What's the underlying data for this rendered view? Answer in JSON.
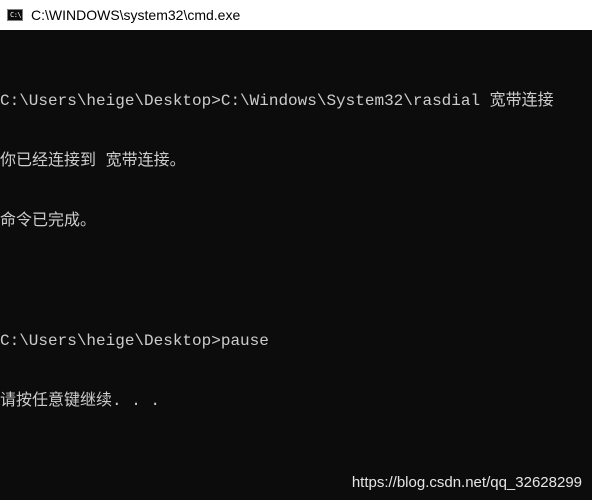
{
  "window": {
    "title": "C:\\WINDOWS\\system32\\cmd.exe",
    "icon": "cmd-icon"
  },
  "console": {
    "lines": [
      "C:\\Users\\heige\\Desktop>C:\\Windows\\System32\\rasdial 宽带连接",
      "你已经连接到 宽带连接。",
      "命令已完成。",
      "",
      "C:\\Users\\heige\\Desktop>pause",
      "请按任意键继续. . ."
    ]
  },
  "watermark": {
    "text": "https://blog.csdn.net/qq_32628299"
  },
  "colors": {
    "background": "#0c0c0c",
    "text": "#cccccc",
    "titlebar": "#ffffff"
  }
}
